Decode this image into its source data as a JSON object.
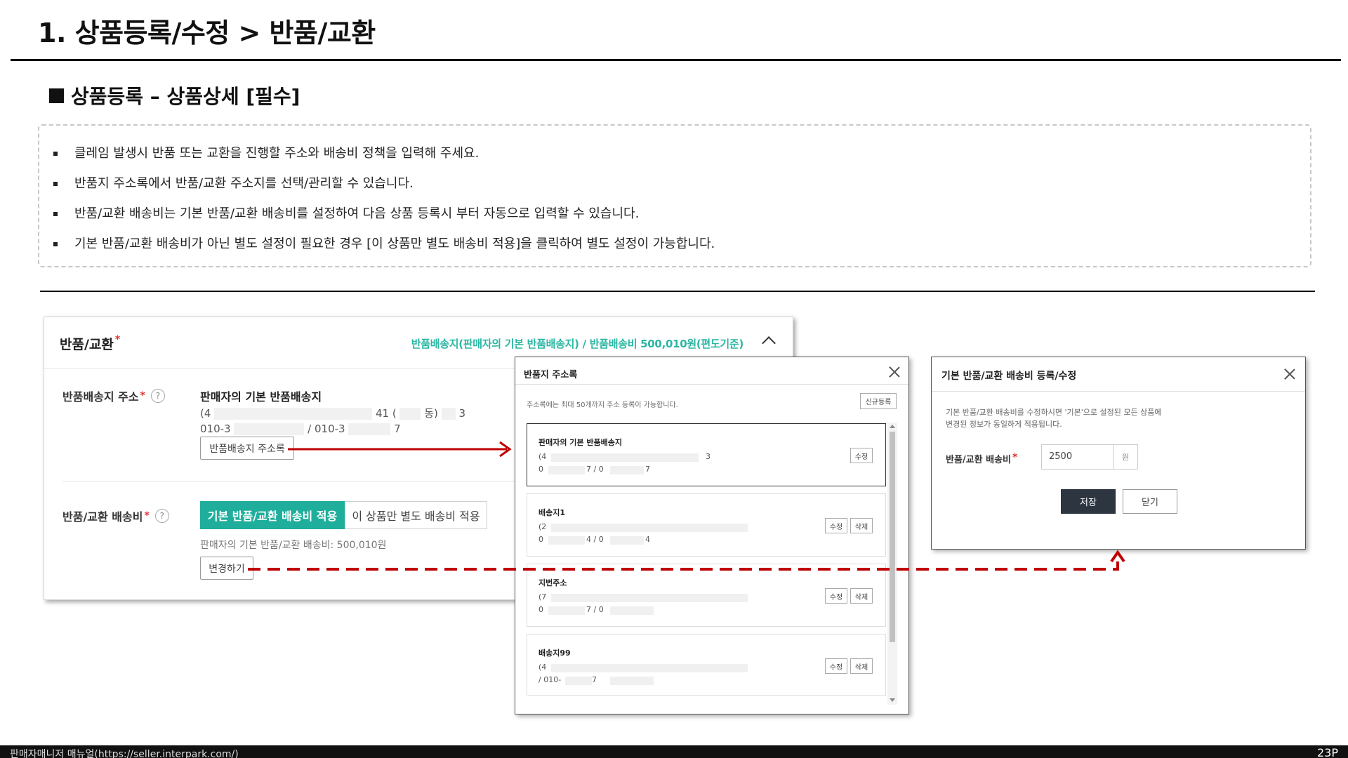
{
  "page": {
    "title": "1. 상품등록/수정 > 반품/교환",
    "section_title": "상품등록 – 상품상세 [필수]"
  },
  "notes": [
    "클레임 발생시 반품 또는 교환을 진행할 주소와 배송비 정책을 입력해 주세요.",
    "반품지 주소록에서 반품/교환 주소지를 선택/관리할 수 있습니다.",
    "반품/교환 배송비는 기본 반품/교환 배송비를 설정하여 다음 상품 등록시 부터 자동으로 입력할 수 있습니다.",
    "기본 반품/교환 배송비가 아닌 별도 설정이 필요한 경우 [이 상품만 별도 배송비 적용]을 클릭하여 별도 설정이 가능합니다."
  ],
  "main_panel": {
    "title": "반품/교환",
    "required_mark": "*",
    "summary": "반품배송지(판매자의 기본 반품배송지) / 반품배송비 500,010원(편도기준)",
    "address_label": "반품배송지 주소",
    "help": "?",
    "address_title": "판매자의 기본 반품배송지",
    "address_line1_start": "(4",
    "address_line1_mid": "41 (",
    "address_line1_dong": "동)",
    "address_line1_end": "3",
    "address_line2_start": "010-3",
    "address_line2_mid": "/ 010-3",
    "address_line2_end": "7",
    "address_book_button": "반품배송지 주소록",
    "fee_label": "반품/교환 배송비",
    "fee_default_option": "기본 반품/교환 배송비 적용",
    "fee_custom_option": "이 상품만 별도 배송비 적용",
    "fee_note": "판매자의 기본 반품/교환 배송비: 500,010원",
    "change_button": "변경하기"
  },
  "address_modal": {
    "title": "반품지 주소록",
    "note": "주소록에는 최대 50개까지 주소 등록이 가능합니다.",
    "new_button": "신규등록",
    "edit_label": "수정",
    "delete_label": "삭제",
    "cards": [
      {
        "title": "판매자의 기본 반품배송지",
        "line1": "(4",
        "line1_end": "3",
        "line2": "0",
        "line2_mid": "7 / 0",
        "line2_end": "7"
      },
      {
        "title": "배송지1",
        "line1": "(2",
        "line1_end": "",
        "line2": "0",
        "line2_mid": "4 / 0",
        "line2_end": "4"
      },
      {
        "title": "지번주소",
        "line1": "(7",
        "line1_end": "",
        "line2": "0",
        "line2_mid": "7 / 0",
        "line2_end": ""
      },
      {
        "title": "배송지99",
        "line1": "(4",
        "line1_end": "",
        "line2": "/ 010-",
        "line2_mid": "7",
        "line2_end": ""
      }
    ]
  },
  "fee_modal": {
    "title": "기본 반품/교환 배송비 등록/수정",
    "desc_line1": "기본 반품/교환 배송비를 수정하시면 '기본'으로 설정된 모든 상품에",
    "desc_line2": "변경된 정보가 동일하게 적용됩니다.",
    "label": "반품/교환 배송비",
    "value": "2500",
    "unit": "원",
    "save_button": "저장",
    "close_button": "닫기"
  },
  "footer": {
    "left": "판매자매니저 매뉴얼(https://seller.interpark.com/)",
    "page": "23P"
  },
  "colors": {
    "accent_teal": "#1fae9b",
    "summary_teal": "#2bb6a3",
    "arrow_red": "#c00000",
    "save_dark": "#2c3540"
  }
}
